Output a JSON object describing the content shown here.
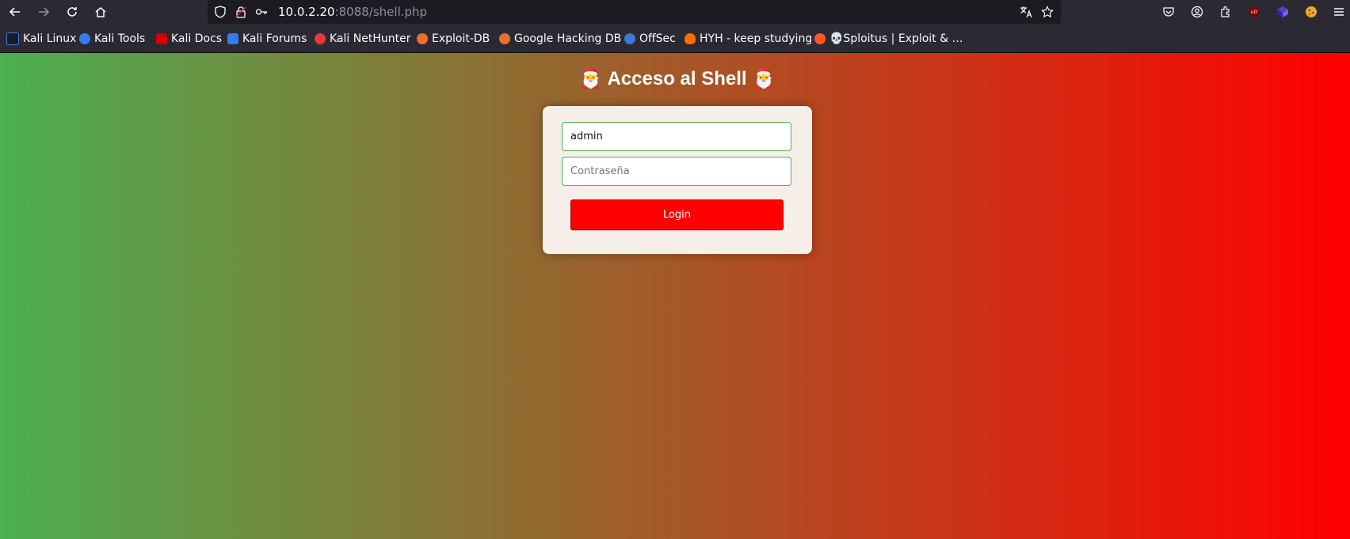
{
  "browser": {
    "url_host": "10.0.2.20",
    "url_rest": ":8088/shell.php"
  },
  "bookmarks": [
    {
      "label": "Kali Linux",
      "icon": "kali-dragon-icon",
      "color": "#367bf0"
    },
    {
      "label": "Kali Tools",
      "icon": "kali-tools-icon",
      "color": "#367bf0"
    },
    {
      "label": "Kali Docs",
      "icon": "kali-docs-icon",
      "color": "#d60000"
    },
    {
      "label": "Kali Forums",
      "icon": "kali-forums-icon",
      "color": "#367bf0"
    },
    {
      "label": "Kali NetHunter",
      "icon": "nethunter-icon",
      "color": "#e53935"
    },
    {
      "label": "Exploit-DB",
      "icon": "exploit-db-icon",
      "color": "#ec6f2c"
    },
    {
      "label": "Google Hacking DB",
      "icon": "ghdb-icon",
      "color": "#ec6f2c"
    },
    {
      "label": "OffSec",
      "icon": "offsec-icon",
      "color": "#3a7bd5"
    },
    {
      "label": "HYH - keep studying",
      "icon": "fire-icon",
      "color": "#ff6d00"
    },
    {
      "label": "💀Sploitus | Exploit & …",
      "icon": "skull-icon",
      "color": "#ff5722"
    }
  ],
  "page": {
    "title": "🎅 Acceso al Shell 🎅",
    "username_value": "admin",
    "password_placeholder": "Contraseña",
    "login_label": "Login"
  },
  "colors": {
    "gradient_start": "#4caf50",
    "gradient_end": "#ff0000",
    "button": "#ff0000",
    "card": "#f6efe9"
  }
}
